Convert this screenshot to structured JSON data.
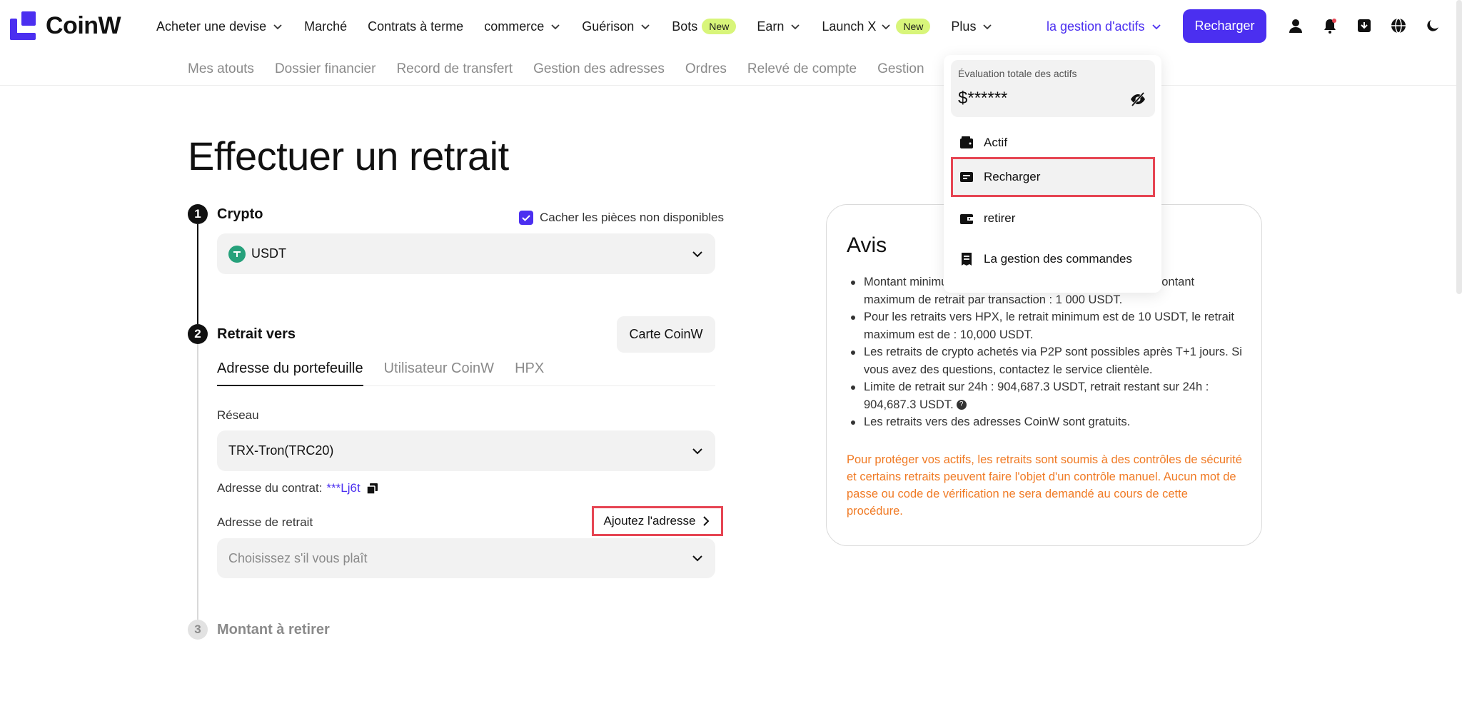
{
  "brand": {
    "name": "CoinW",
    "accent": "#4b2ff0",
    "warn": "#f07a24",
    "highlight": "#e64553",
    "badge": "#d8f57a"
  },
  "nav": {
    "items": [
      {
        "label": "Acheter une devise",
        "chevron": true,
        "badge": ""
      },
      {
        "label": "Marché",
        "chevron": false,
        "badge": ""
      },
      {
        "label": "Contrats à terme",
        "chevron": false,
        "badge": ""
      },
      {
        "label": "commerce",
        "chevron": true,
        "badge": ""
      },
      {
        "label": "Guérison",
        "chevron": true,
        "badge": ""
      },
      {
        "label": "Bots",
        "chevron": false,
        "badge": "New"
      },
      {
        "label": "Earn",
        "chevron": true,
        "badge": ""
      },
      {
        "label": "Launch X",
        "chevron": true,
        "badge": "New"
      },
      {
        "label": "Plus",
        "chevron": true,
        "badge": ""
      }
    ],
    "asset_menu": "la gestion d'actifs",
    "recharge_button": "Recharger",
    "icons": [
      "user-icon",
      "bell-icon",
      "download-icon",
      "globe-icon",
      "moon-icon"
    ]
  },
  "subnav": {
    "items": [
      "Mes atouts",
      "Dossier financier",
      "Record de transfert",
      "Gestion des adresses",
      "Ordres",
      "Relevé de compte",
      "Gestion"
    ]
  },
  "page": {
    "title": "Effectuer un retrait"
  },
  "step1": {
    "number": "1",
    "label": "Crypto",
    "hide_unavailable": "Cacher les pièces non disponibles",
    "hide_unavailable_checked": true,
    "selected_coin": "USDT"
  },
  "step2": {
    "number": "2",
    "label": "Retrait vers",
    "card_button": "Carte CoinW",
    "tabs": [
      "Adresse du portefeuille",
      "Utilisateur CoinW",
      "HPX"
    ],
    "active_tab": 0,
    "network_label": "Réseau",
    "network_value": "TRX-Tron(TRC20)",
    "contract_label": "Adresse du contrat:",
    "contract_value": "***Lj6t",
    "address_label": "Adresse de retrait",
    "add_address": "Ajoutez l'adresse",
    "address_placeholder": "Choisissez s'il vous plaît"
  },
  "step3": {
    "number": "3",
    "label": "Montant à retirer"
  },
  "notice": {
    "title": "Avis",
    "items": [
      "Montant minimum de retrait par transaction : 10 USDT, montant maximum de retrait par transaction : 1 000 USDT.",
      "Pour les retraits vers HPX, le retrait minimum est de 10 USDT, le retrait maximum est de : 10,000 USDT.",
      "Les retraits de crypto achetés via P2P sont possibles après T+1 jours. Si vous avez des questions, contactez le service clientèle.",
      "Limite de retrait sur 24h : 904,687.3 USDT, retrait restant sur 24h : 904,687.3 USDT.",
      "Les retraits vers des adresses CoinW sont gratuits."
    ],
    "warning": "Pour protéger vos actifs, les retraits sont soumis à des contrôles de sécurité et certains retraits peuvent faire l'objet d'un contrôle manuel. Aucun mot de passe ou code de vérification ne sera demandé au cours de cette procédure."
  },
  "dropdown": {
    "asset_label": "Évaluation totale des actifs",
    "asset_value": "$******",
    "items": [
      {
        "label": "Actif",
        "icon": "wallet-icon"
      },
      {
        "label": "Recharger",
        "icon": "deposit-icon"
      },
      {
        "label": "retirer",
        "icon": "withdraw-icon"
      },
      {
        "label": "La gestion des commandes",
        "icon": "orders-icon"
      }
    ]
  }
}
